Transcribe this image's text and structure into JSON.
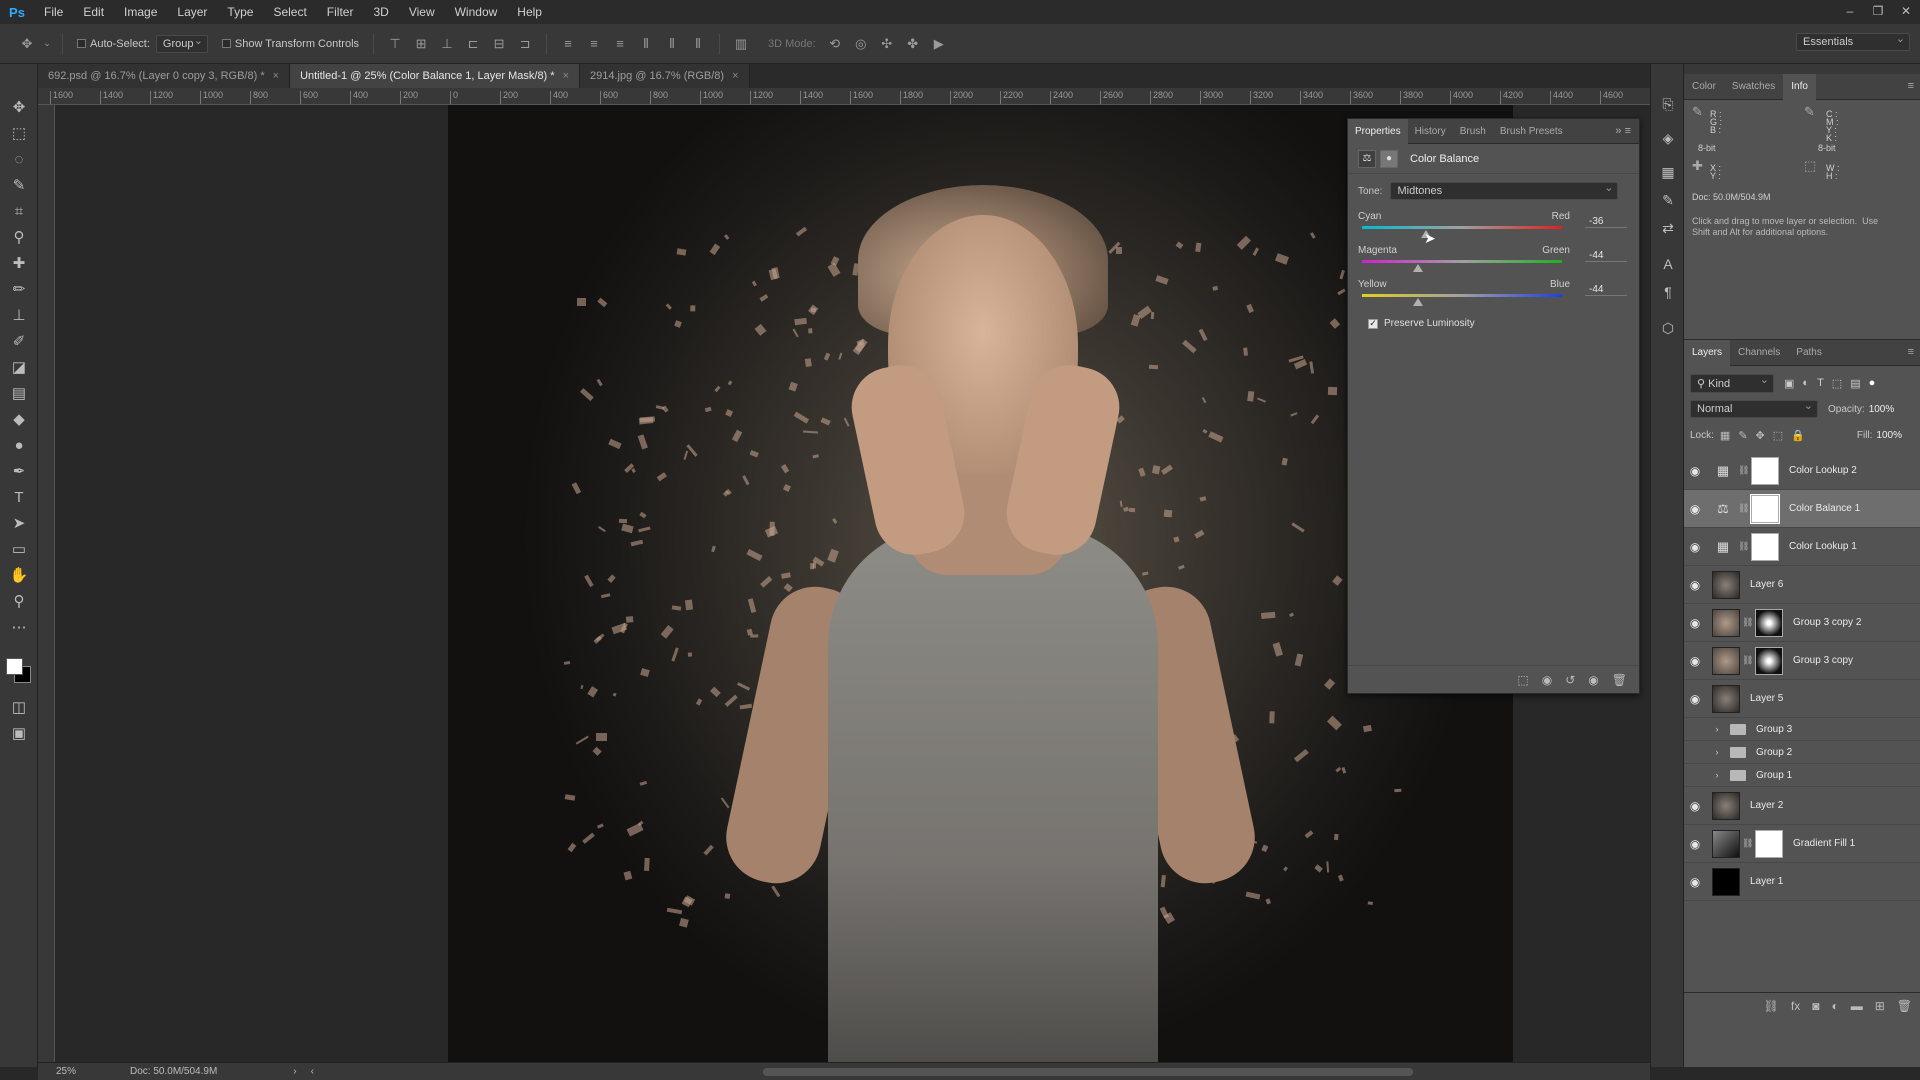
{
  "app": {
    "logo": "Ps"
  },
  "menu": [
    "File",
    "Edit",
    "Image",
    "Layer",
    "Type",
    "Select",
    "Filter",
    "3D",
    "View",
    "Window",
    "Help"
  ],
  "window_controls": [
    "–",
    "❐",
    "✕"
  ],
  "options": {
    "auto_select_label": "Auto-Select:",
    "auto_select_value": "Group",
    "show_transform_label": "Show Transform Controls",
    "mode_3d_label": "3D Mode:",
    "workspace": "Essentials"
  },
  "doc_tabs": [
    {
      "label": "692.psd @ 16.7% (Layer 0 copy 3, RGB/8) *",
      "close": "×"
    },
    {
      "label": "Untitled-1 @ 25% (Color Balance 1, Layer Mask/8) *",
      "close": "×"
    },
    {
      "label": "2914.jpg @ 16.7% (RGB/8)",
      "close": "×"
    }
  ],
  "ruler_ticks": [
    "1600",
    "1400",
    "1200",
    "1000",
    "800",
    "600",
    "400",
    "200",
    "0",
    "200",
    "400",
    "600",
    "800",
    "1000",
    "1200",
    "1400",
    "1600",
    "1800",
    "2000",
    "2200",
    "2400",
    "2600",
    "2800",
    "3000",
    "3200",
    "3400",
    "3600",
    "3800",
    "4000",
    "4200",
    "4400",
    "4600"
  ],
  "properties": {
    "tabs": [
      "Properties",
      "History",
      "Brush",
      "Brush Presets"
    ],
    "title": "Color Balance",
    "tone_label": "Tone:",
    "tone_value": "Midtones",
    "sliders": [
      {
        "left": "Cyan",
        "right": "Red",
        "value": "-36",
        "fraction": 0.32,
        "gradient": [
          "#00bcd4",
          "#e02020"
        ]
      },
      {
        "left": "Magenta",
        "right": "Green",
        "value": "-44",
        "fraction": 0.28,
        "gradient": [
          "#d020d0",
          "#20b020"
        ]
      },
      {
        "left": "Yellow",
        "right": "Blue",
        "value": "-44",
        "fraction": 0.28,
        "gradient": [
          "#e0d020",
          "#2040e0"
        ]
      }
    ],
    "preserve_label": "Preserve Luminosity",
    "preserve_checked": true
  },
  "info_panel": {
    "tabs": [
      "Color",
      "Swatches",
      "Info"
    ],
    "rgb": "R :\nG :\nB :",
    "cmyk": "C :\nM :\nY :\nK :",
    "bit_left": "8-bit",
    "bit_right": "8-bit",
    "xy": "X :\nY :",
    "wh": "W :\nH :",
    "doc": "Doc: 50.0M/504.9M",
    "hint": "Click and drag to move layer or selection.  Use\nShift and Alt for additional options."
  },
  "layers_panel": {
    "tabs": [
      "Layers",
      "Channels",
      "Paths"
    ],
    "kind_label": "Kind",
    "blend_mode": "Normal",
    "opacity_label": "Opacity:",
    "opacity_value": "100%",
    "lock_label": "Lock:",
    "fill_label": "Fill:",
    "fill_value": "100%",
    "layers": [
      {
        "name": "Color Lookup 2",
        "visible": true,
        "kind": "lookup"
      },
      {
        "name": "Color Balance 1",
        "visible": true,
        "kind": "balance",
        "selected": true
      },
      {
        "name": "Color Lookup 1",
        "visible": true,
        "kind": "lookup"
      },
      {
        "name": "Layer 6",
        "visible": true,
        "kind": "pixel"
      },
      {
        "name": "Group 3 copy 2",
        "visible": true,
        "kind": "pixel-mask"
      },
      {
        "name": "Group 3 copy",
        "visible": true,
        "kind": "pixel-mask"
      },
      {
        "name": "Layer 5",
        "visible": true,
        "kind": "pixel"
      },
      {
        "name": "Group 3",
        "visible": false,
        "kind": "group"
      },
      {
        "name": "Group 2",
        "visible": false,
        "kind": "group"
      },
      {
        "name": "Group 1",
        "visible": false,
        "kind": "group"
      },
      {
        "name": "Layer 2",
        "visible": true,
        "kind": "pixel"
      },
      {
        "name": "Gradient Fill 1",
        "visible": true,
        "kind": "gradient"
      },
      {
        "name": "Layer 1",
        "visible": true,
        "kind": "black"
      }
    ]
  },
  "status": {
    "zoom": "25%",
    "doc": "Doc: 50.0M/504.9M"
  }
}
